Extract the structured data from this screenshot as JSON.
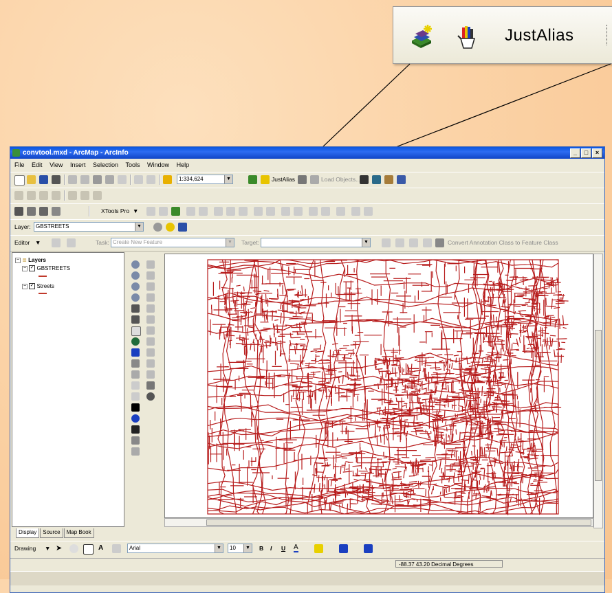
{
  "callout": {
    "icon1": "add-data-sparkle-icon",
    "icon2": "color-hand-icon",
    "label": "JustAlias"
  },
  "window": {
    "title": "convtool.mxd - ArcMap - ArcInfo",
    "controls": {
      "minimize": "_",
      "maximize": "□",
      "close": "×"
    }
  },
  "menu": [
    "File",
    "Edit",
    "View",
    "Insert",
    "Selection",
    "Tools",
    "Window",
    "Help"
  ],
  "standard_toolbar": {
    "scale": "1:334,624",
    "justalias_label": "JustAlias",
    "load_objects_label": "Load Objects..."
  },
  "xtools": {
    "label": "XTools Pro"
  },
  "layer_toolbar": {
    "label": "Layer:",
    "value": "GBSTREETS"
  },
  "editor_toolbar": {
    "editor_label": "Editor",
    "task_label": "Task:",
    "task_value": "Create New Feature",
    "target_label": "Target:",
    "convert_label": "Convert Annotation Class to Feature Class"
  },
  "toc": {
    "root": "Layers",
    "layers": [
      {
        "name": "GBSTREETS",
        "checked": true
      },
      {
        "name": "Streets",
        "checked": true
      }
    ],
    "tabs": [
      "Display",
      "Source",
      "Map Book"
    ]
  },
  "map": {
    "line_color": "#b71c1c"
  },
  "drawing_toolbar": {
    "label": "Drawing",
    "font": "Arial",
    "size": "10",
    "bold": "B",
    "italic": "I",
    "underline": "U",
    "font_color_glyph": "A"
  },
  "status": {
    "coords": "-88.37  43.20 Decimal Degrees"
  }
}
